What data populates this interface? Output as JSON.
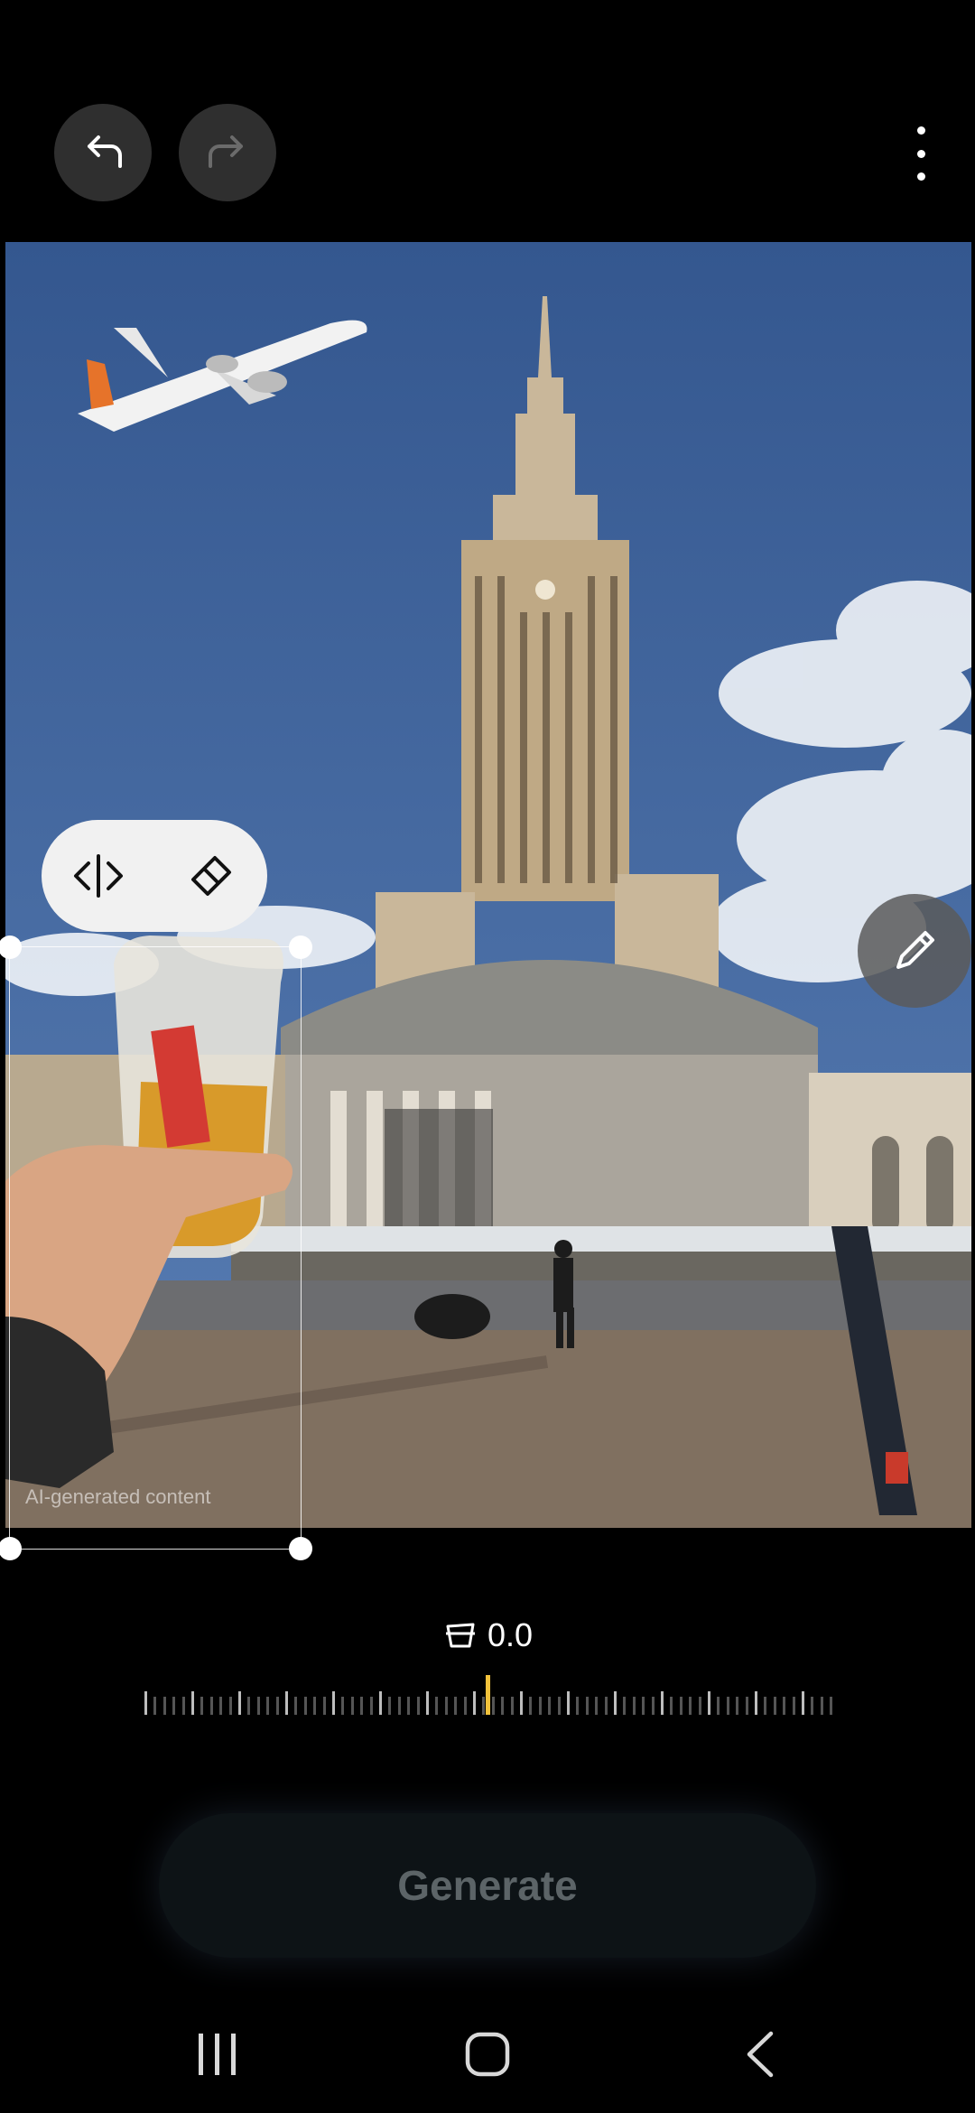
{
  "toolbar": {
    "undo_icon": "undo-icon",
    "redo_icon": "redo-icon",
    "more_icon": "more-vertical-icon"
  },
  "photo": {
    "watermark": "AI-generated content"
  },
  "floating_toolbar": {
    "items": [
      "flip-horizontal-icon",
      "eraser-icon"
    ]
  },
  "edit_button": {
    "icon": "pencil-icon"
  },
  "adjust": {
    "icon": "perspective-icon",
    "value": "0.0"
  },
  "generate": {
    "label": "Generate"
  },
  "nav": {
    "items": [
      "recents-icon",
      "home-icon",
      "back-icon"
    ]
  }
}
